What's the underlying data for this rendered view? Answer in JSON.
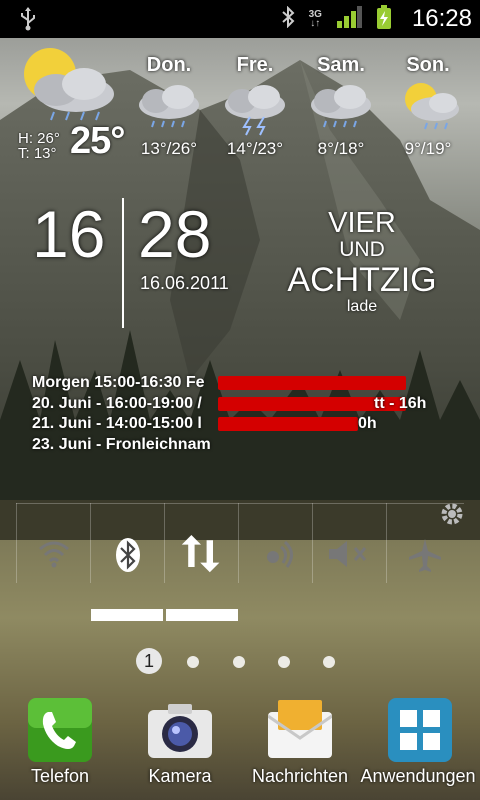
{
  "status_bar": {
    "time": "16:28",
    "network_type": "3G",
    "icons": [
      "usb-icon",
      "bluetooth-icon",
      "signal-icon",
      "battery-charging-icon"
    ]
  },
  "weather": {
    "current": {
      "high_label": "H: 26°",
      "low_label": "T: 13°",
      "temperature": "25°",
      "icon": "partly-cloudy-rain-icon"
    },
    "forecast": [
      {
        "day": "Don.",
        "range": "13°/26°",
        "icon": "rain-cloud-icon"
      },
      {
        "day": "Fre.",
        "range": "14°/23°",
        "icon": "thunderstorm-icon"
      },
      {
        "day": "Sam.",
        "range": "8°/18°",
        "icon": "rain-cloud-icon"
      },
      {
        "day": "Son.",
        "range": "9°/19°",
        "icon": "sun-cloud-icon"
      }
    ]
  },
  "clock": {
    "hour": "16",
    "minute": "28",
    "date": "16.06.2011",
    "words": [
      "VIER",
      "UND",
      "ACHTZIG",
      "lade"
    ]
  },
  "calendar": {
    "events": [
      {
        "text": "Morgen 15:00-16:30 Fe",
        "tail": ""
      },
      {
        "text": "20. Juni - 16:00-19:00 /",
        "tail": "tt - 16h"
      },
      {
        "text": "21. Juni - 14:00-15:00 l",
        "tail": "0h"
      },
      {
        "text": "23. Juni - Fronleichnam",
        "tail": ""
      }
    ]
  },
  "power_widget": {
    "toggles": [
      "wifi-icon",
      "bluetooth-icon",
      "data-sync-icon",
      "gps-icon",
      "mute-icon",
      "airplane-icon"
    ],
    "settings_icon": "gear-icon",
    "enabled": [
      false,
      true,
      true,
      false,
      false,
      false
    ]
  },
  "page_indicator": {
    "current": "1",
    "total": 5
  },
  "dock": {
    "items": [
      {
        "label": "Telefon",
        "icon": "phone-icon",
        "color": "#3a9a1e"
      },
      {
        "label": "Kamera",
        "icon": "camera-icon",
        "color": "#e8e8e8"
      },
      {
        "label": "Nachrichten",
        "icon": "envelope-icon",
        "color": "#f0b030"
      },
      {
        "label": "Anwendungen",
        "icon": "apps-grid-icon",
        "color": "#2a8fbf"
      }
    ]
  }
}
